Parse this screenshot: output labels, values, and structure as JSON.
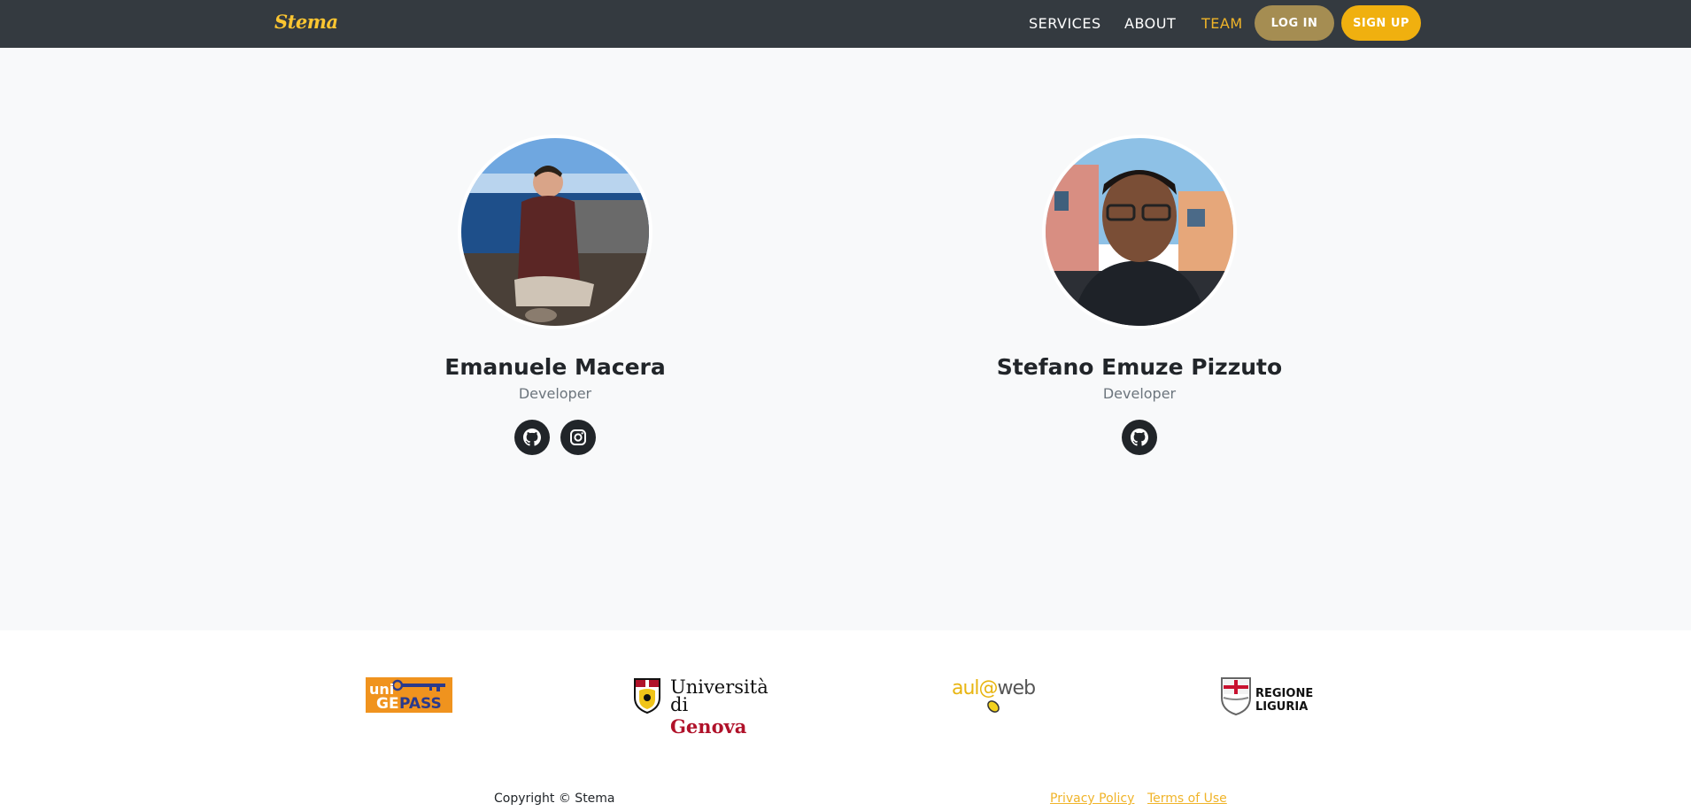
{
  "nav": {
    "brand": "Stema",
    "links": [
      "SERVICES",
      "ABOUT",
      "TEAM"
    ],
    "active": "TEAM",
    "login_label": "LOG IN",
    "signup_label": "SIGN UP"
  },
  "team": [
    {
      "name": "Emanuele Macera",
      "role": "Developer",
      "socials": [
        "github-icon",
        "instagram-icon"
      ]
    },
    {
      "name": "Stefano Emuze Pizzuto",
      "role": "Developer",
      "socials": [
        "github-icon"
      ]
    }
  ],
  "logos": {
    "unigepass": {
      "uni": "uni",
      "ge": "GE",
      "pass": "PASS"
    },
    "unige": {
      "line1": "Università",
      "line2_a": "di ",
      "line2_b": "Genova"
    },
    "aulaweb": {
      "a": "aul",
      "at": "@",
      "b": "web"
    },
    "regione": "REGIONE LIGURIA"
  },
  "footer": {
    "copyright": "Copyright © Stema",
    "privacy": "Privacy Policy",
    "terms": "Terms of Use"
  },
  "colors": {
    "navbar": "#343a40",
    "accent": "#f0b429",
    "login": "#a58d52",
    "signup": "#f0b00f"
  }
}
